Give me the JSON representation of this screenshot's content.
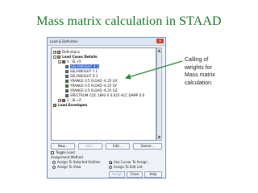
{
  "slide": {
    "title": "Mass matrix calculation in STAAD"
  },
  "dialog": {
    "title": "Load & Definition",
    "close_glyph": "x",
    "tree": {
      "definitions": "Definitions",
      "load_cases_details": "Load Cases Details",
      "case1": "1 : EL+X",
      "items": [
        "SELFWEIGHT X 1",
        "SELFWEIGHT Y 1",
        "SELFWEIGHT Z 1",
        "YRANGE 0.5 FLOAD -6.25 GX",
        "YRANGE 0.5 FLOAD -6.25 GY",
        "YRANGE 0.5 FLOAD -6.25 GZ",
        "SPECTRUM CQC 1893 X 0.025 ACC DAMP 0.0"
      ],
      "case2": "2 : EL+Z",
      "load_envelopes": "Load Envelopes"
    },
    "buttons": {
      "new": "New...",
      "add": "Add...",
      "edit": "Edit...",
      "delete": "Delete...",
      "assign": "Assign",
      "close": "Close",
      "help": "Help"
    },
    "toggle_load": "Toggle Load",
    "assignment_method": "Assignment Method",
    "radios": {
      "assign_selected": "Assign To Selected Entities",
      "use_cursor": "Use Cursor To Assign",
      "assign_view": "Assign To View",
      "assign_edit_list": "Assign To Edit List"
    }
  },
  "callout": {
    "lines": [
      "Calling of",
      "weights for",
      "Mass matrix",
      "calculation"
    ]
  },
  "colors": {
    "title_green": "#1a7a2c",
    "selection_blue": "#3d6bd1",
    "arrow_green": "#2e8b3a"
  }
}
